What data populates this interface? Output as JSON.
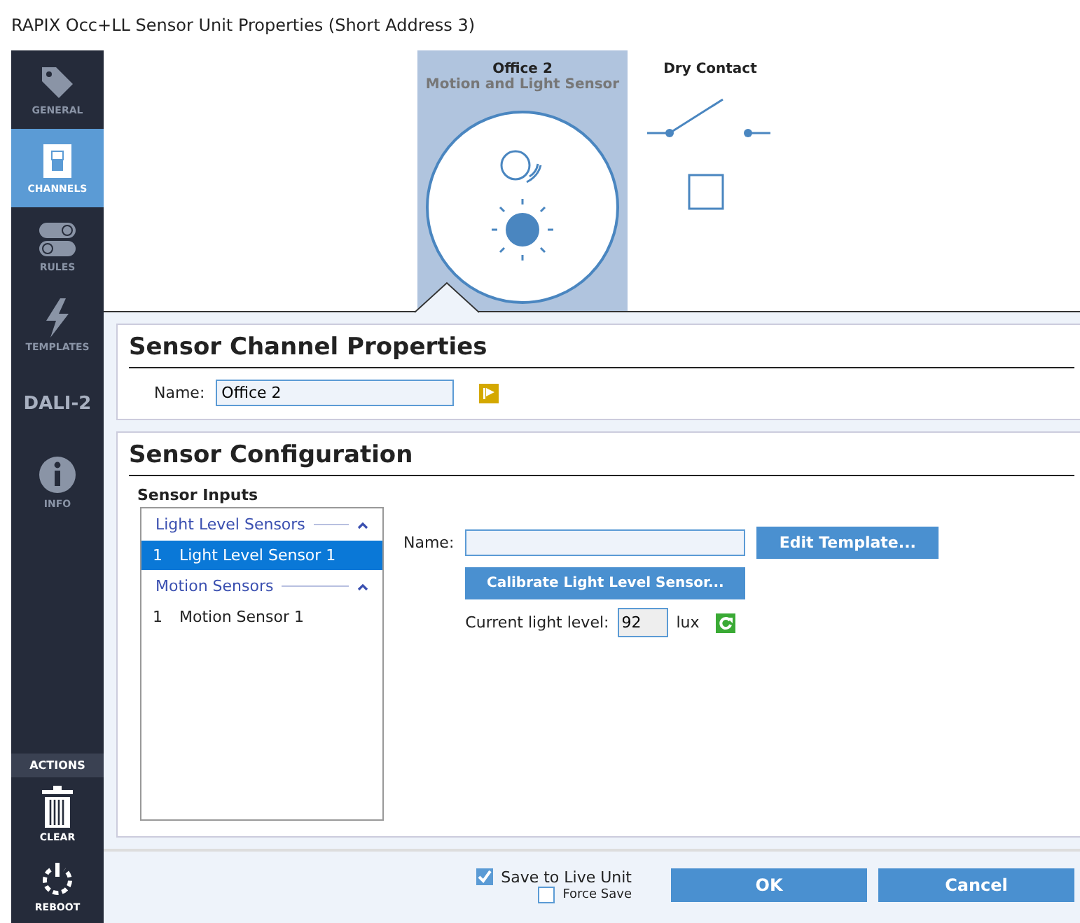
{
  "window": {
    "title": "RAPIX Occ+LL Sensor Unit Properties (Short Address 3)"
  },
  "sidebar": {
    "items": [
      {
        "kind": "tag",
        "label": "GENERAL",
        "selected": false
      },
      {
        "kind": "switch",
        "label": "CHANNELS",
        "selected": true
      },
      {
        "kind": "toggles",
        "label": "RULES",
        "selected": false
      },
      {
        "kind": "bolt",
        "label": "TEMPLATES",
        "selected": false
      },
      {
        "kind": "text",
        "label": "DALI-2",
        "selected": false
      },
      {
        "kind": "info",
        "label": "INFO",
        "selected": false
      }
    ],
    "actions_header": "ACTIONS",
    "actions": [
      {
        "kind": "trash",
        "label": "CLEAR"
      },
      {
        "kind": "power",
        "label": "REBOOT"
      }
    ]
  },
  "channels": [
    {
      "kind": "sensor",
      "title": "Office 2",
      "subtitle": "Motion and Light Sensor",
      "selected": true
    },
    {
      "kind": "contact",
      "title": "Dry Contact",
      "selected": false
    }
  ],
  "channel_properties": {
    "title": "Sensor Channel Properties",
    "name_label": "Name:",
    "name_value": "Office 2"
  },
  "sensor_configuration": {
    "title": "Sensor Configuration",
    "inputs_label": "Sensor Inputs",
    "groups": [
      {
        "title": "Light Level Sensors",
        "expanded": true,
        "items": [
          {
            "number": "1",
            "label": "Light Level Sensor 1",
            "selected": true
          }
        ]
      },
      {
        "title": "Motion Sensors",
        "expanded": true,
        "items": [
          {
            "number": "1",
            "label": "Motion Sensor 1",
            "selected": false
          }
        ]
      }
    ],
    "name_label": "Name:",
    "edit_button": "Edit Template...",
    "calibrate_button": "Calibrate Light Level Sensor...",
    "light_label": "Current light level:",
    "light_value": "92",
    "light_unit": "lux"
  },
  "footer": {
    "save_live": {
      "label": "Save to Live Unit",
      "checked": true
    },
    "force_save": {
      "label": "Force Save",
      "checked": false
    },
    "buttons": [
      "OK",
      "Cancel"
    ]
  }
}
